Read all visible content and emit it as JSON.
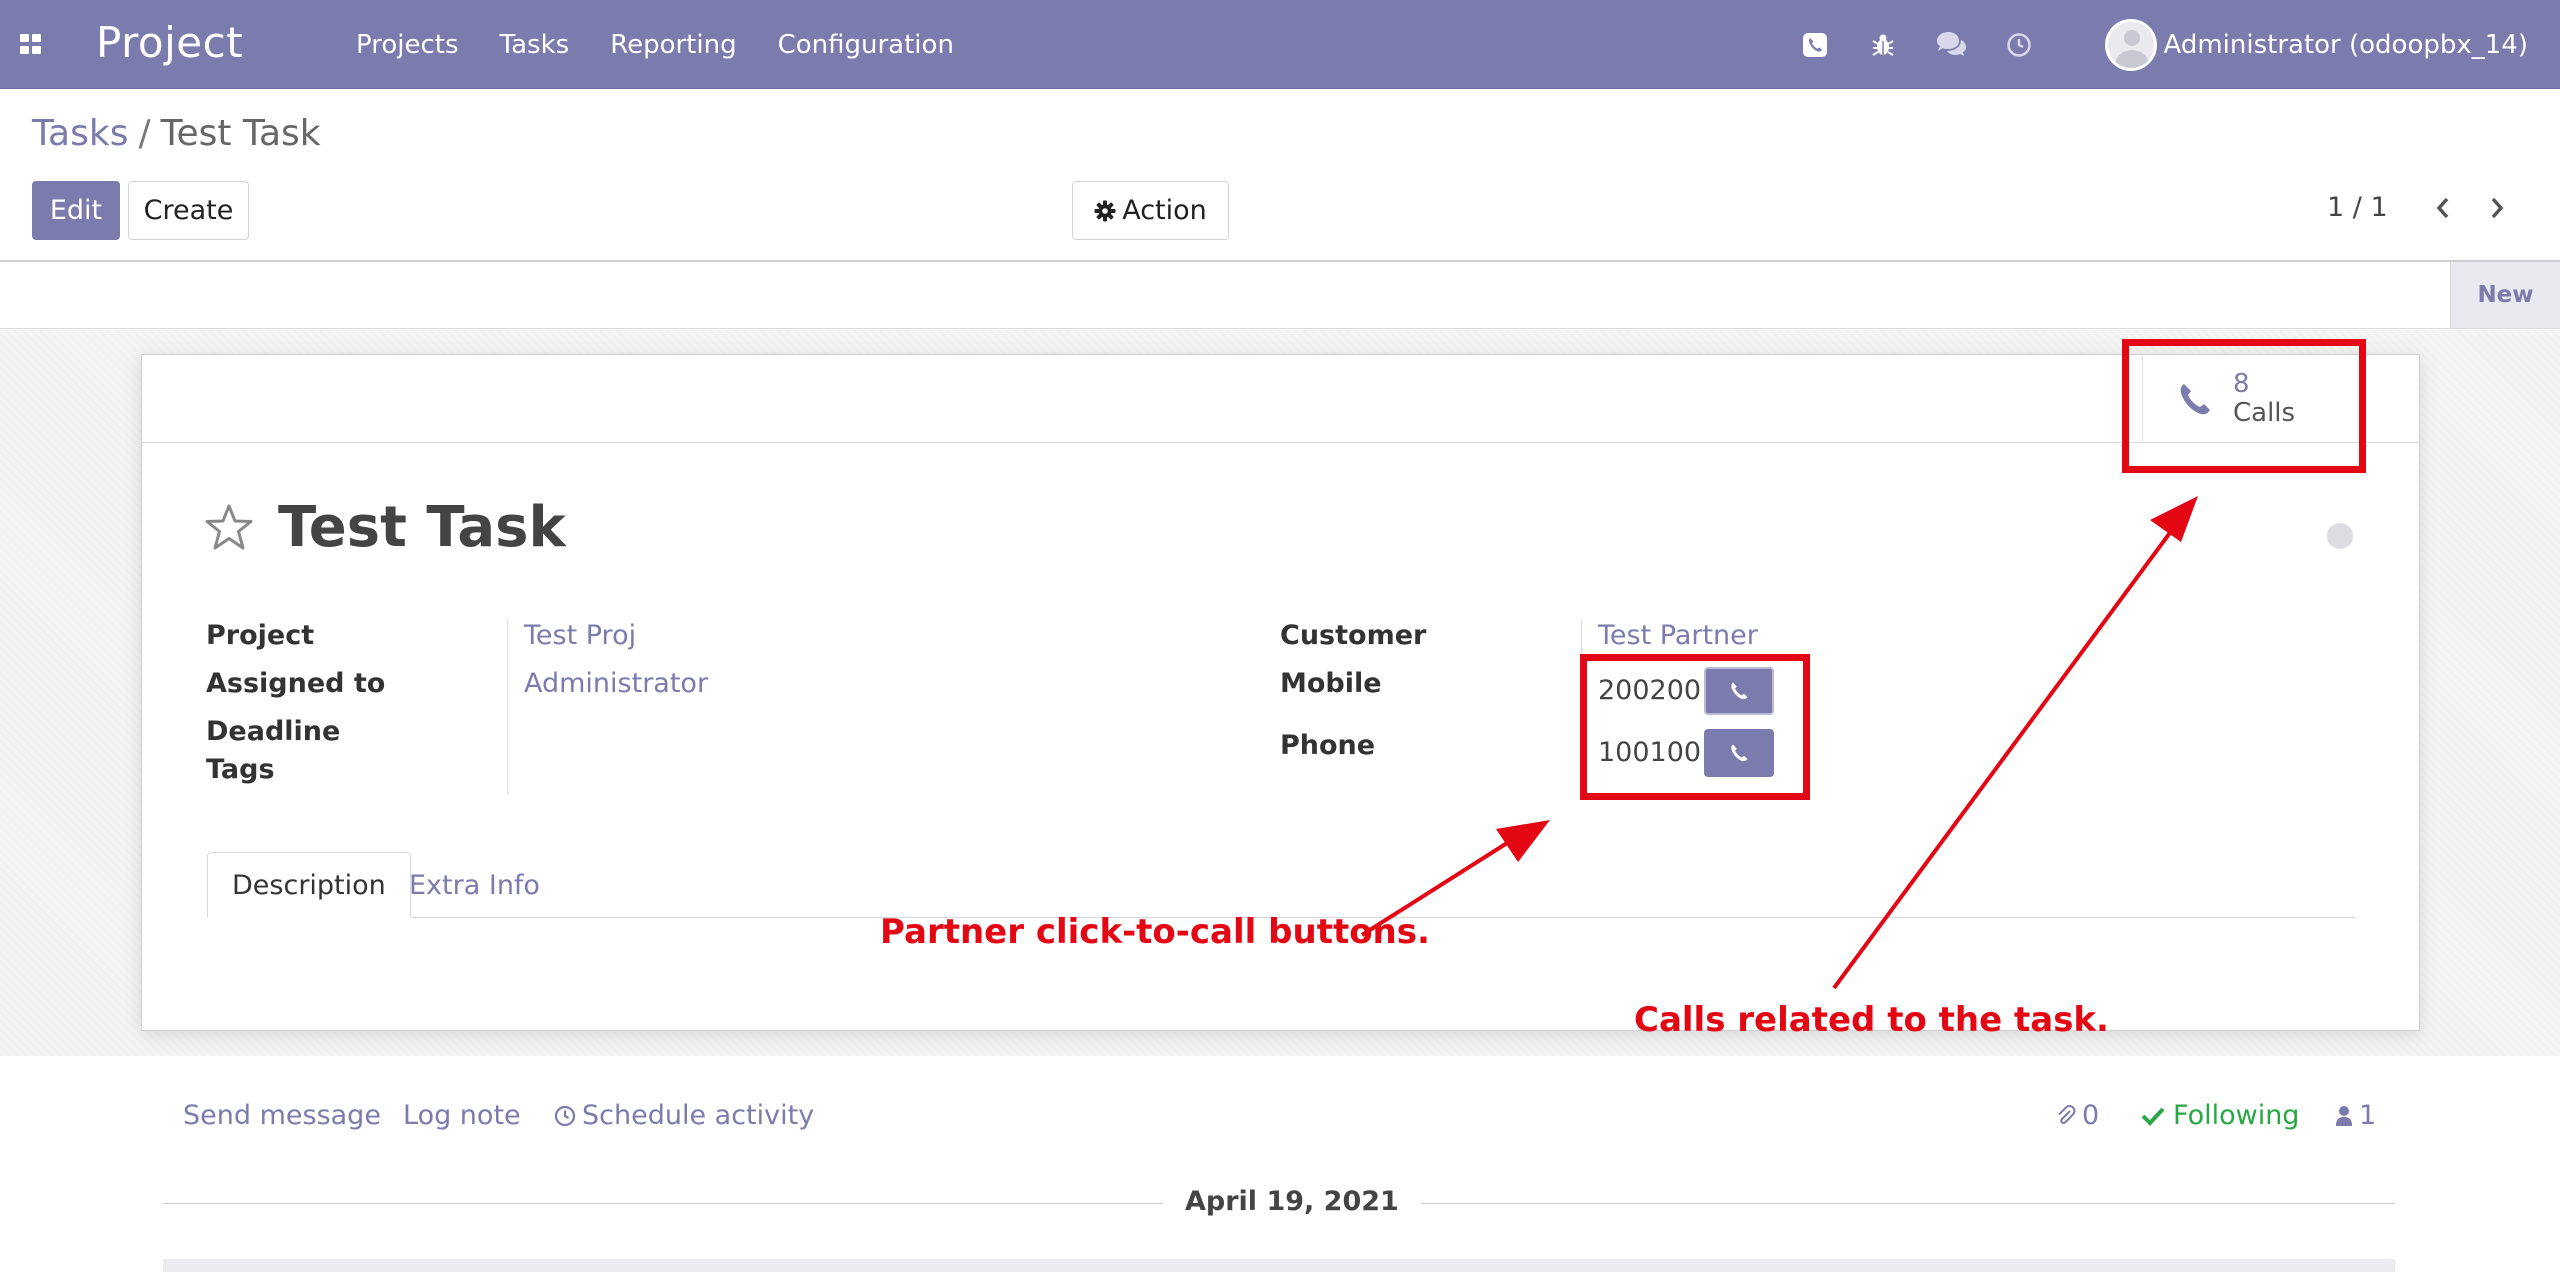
{
  "navbar": {
    "app_name": "Project",
    "menu": [
      "Projects",
      "Tasks",
      "Reporting",
      "Configuration"
    ],
    "systray_icons": [
      "phone-icon",
      "bug-icon",
      "chat-icon",
      "clock-icon"
    ],
    "user": "Administrator (odoopbx_14)",
    "background_color": "#7c7bad"
  },
  "breadcrumb": {
    "parent": "Tasks",
    "separator": "/",
    "current": "Test Task"
  },
  "toolbar": {
    "edit": "Edit",
    "create": "Create",
    "action": "Action"
  },
  "pager": {
    "value": "1 / 1"
  },
  "statusbar": {
    "stage": "New"
  },
  "smart_button": {
    "value": "8",
    "label": "Calls"
  },
  "task": {
    "title": "Test Task",
    "fields_left": [
      {
        "label": "Project",
        "value": "Test Proj"
      },
      {
        "label": "Assigned to",
        "value": "Administrator"
      },
      {
        "label": "Deadline",
        "value": ""
      },
      {
        "label": "Tags",
        "value": ""
      }
    ],
    "fields_right": [
      {
        "label": "Customer",
        "value": "Test Partner"
      },
      {
        "label": "Mobile",
        "value": "200200"
      },
      {
        "label": "Phone",
        "value": "100100"
      }
    ]
  },
  "tabs": [
    "Description",
    "Extra Info"
  ],
  "annotations": {
    "click_to_call": "Partner click-to-call buttons.",
    "calls_related": "Calls related to the task.",
    "color": "#e30613"
  },
  "chatter": {
    "send_message": "Send message",
    "log_note": "Log note",
    "schedule_activity": "Schedule activity",
    "attachments_count": "0",
    "following": "Following",
    "followers_count": "1",
    "date": "April 19, 2021"
  }
}
